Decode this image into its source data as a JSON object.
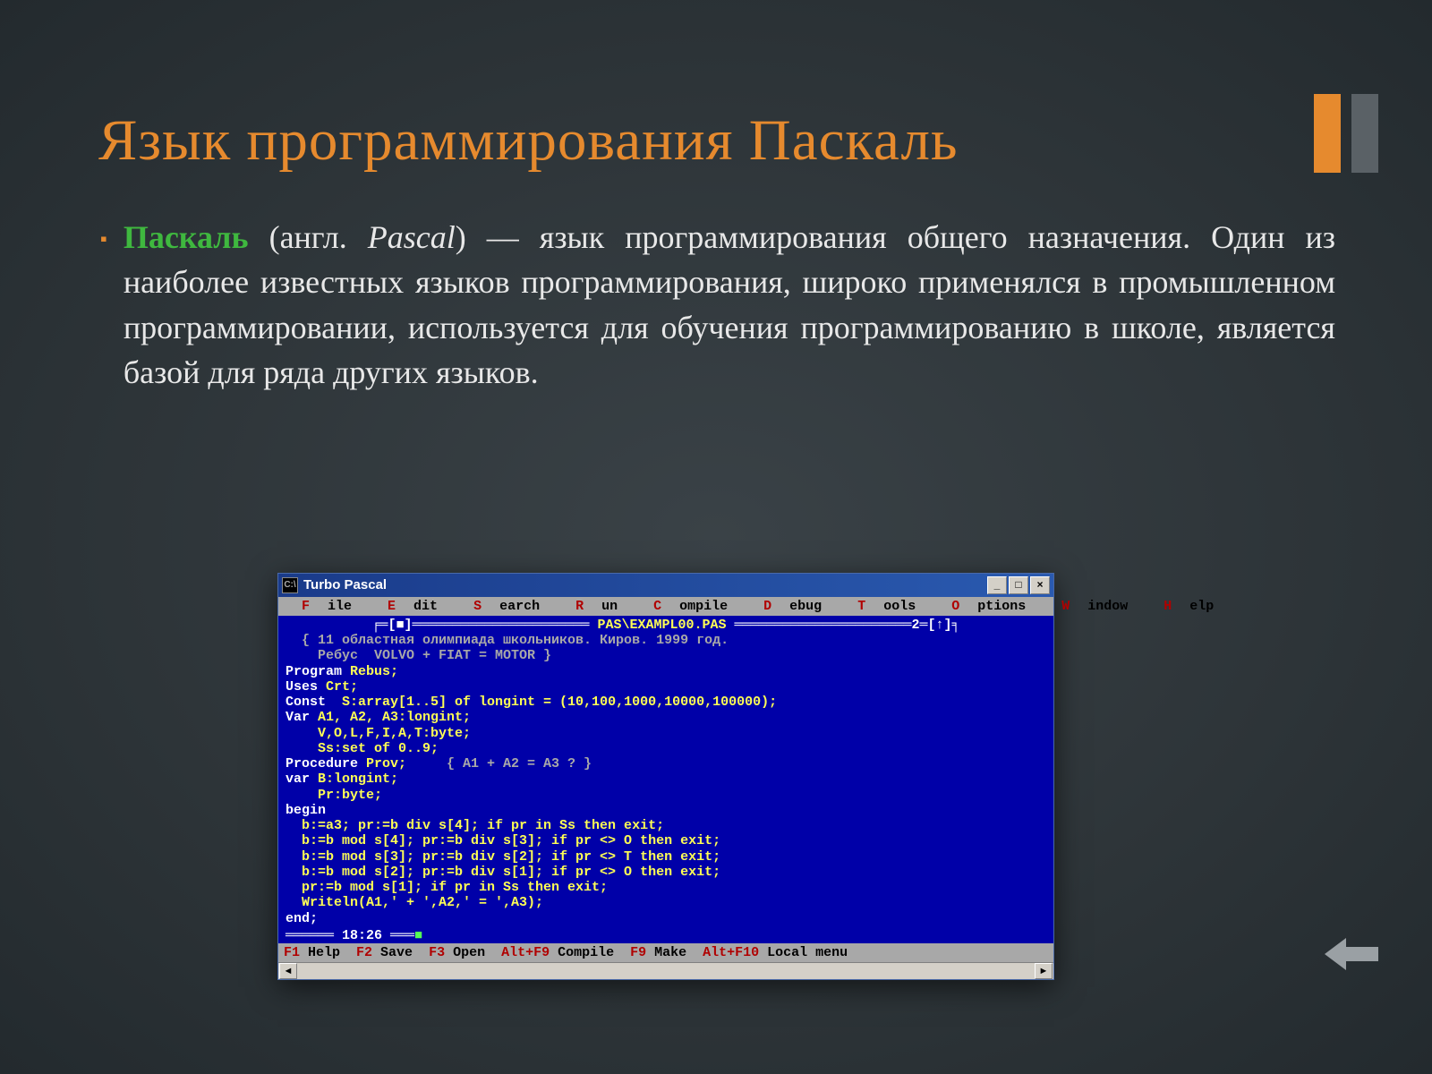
{
  "slide": {
    "title": "Язык программирования Паскаль",
    "bullet_glyph": "▪",
    "term": "Паскаль",
    "parenthetical_prefix": " (англ. ",
    "english_name": "Pascal",
    "parenthetical_suffix": ") — язык программирования общего назначения. Один из наиболее известных языков программирования, широко применялся в промышленном программировании, используется для обучения программированию в школе, является базой для ряда других языков."
  },
  "tp_window": {
    "title": "Turbo Pascal",
    "sys_icon": "C:\\",
    "min": "_",
    "max": "□",
    "close": "×",
    "menu": {
      "file": {
        "hot": "F",
        "rest": "ile"
      },
      "edit": {
        "hot": "E",
        "rest": "dit"
      },
      "search": {
        "hot": "S",
        "rest": "earch"
      },
      "run": {
        "hot": "R",
        "rest": "un"
      },
      "compile": {
        "hot": "C",
        "rest": "ompile"
      },
      "debug": {
        "hot": "D",
        "rest": "ebug"
      },
      "tools": {
        "hot": "T",
        "rest": "ools"
      },
      "options": {
        "hot": "O",
        "rest": "ptions"
      },
      "window": {
        "hot": "W",
        "rest": "indow"
      },
      "help": {
        "hot": "H",
        "rest": "elp"
      }
    },
    "file_header_prefix": "╒═[■]══════════════════════ ",
    "file_header_name": "PAS\\EXAMPL00.PAS",
    "file_header_suffix": " ══════════════════════2═[↑]╕",
    "code": {
      "l1a": "  { 11 областная олимпиада школьников. Киров. 1999 год.",
      "l1b": "    Ребус  VOLVO + FIAT = MOTOR }",
      "l2": "Program ",
      "l2b": "Rebus;",
      "l3": "Uses ",
      "l3b": "Crt;",
      "l4": "Const  ",
      "l4b": "S:array[1..5] of longint = (10,100,1000,10000,100000);",
      "l5": "Var ",
      "l5b": "A1, A2, A3:longint;",
      "l5c": "    V,O,L,F,I,A,T:byte;",
      "l5d": "    Ss:set of 0..9;",
      "l6": "Procedure ",
      "l6b": "Prov;     ",
      "l6c": "{ A1 + A2 = A3 ? }",
      "l7": "var ",
      "l7b": "B:longint;",
      "l7c": "    Pr:byte;",
      "l8": "begin",
      "l9a": "  b:=a3; pr:=b div s[4]; if pr in Ss then exit;",
      "l9b": "  b:=b mod s[4]; pr:=b div s[3]; if pr <> O then exit;",
      "l9c": "  b:=b mod s[3]; pr:=b div s[2]; if pr <> T then exit;",
      "l9d": "  b:=b mod s[2]; pr:=b div s[1]; if pr <> O then exit;",
      "l9e": "  pr:=b mod s[1]; if pr in Ss then exit;",
      "l9f": "  Writeln(A1,' + ',A2,' = ',A3);",
      "l10": "end;"
    },
    "clock_prefix": "══════ ",
    "clock": "18:26",
    "clock_suffix": " ═══",
    "scroll_marker": "■",
    "status": {
      "f1k": "F1",
      "f1t": " Help  ",
      "f2k": "F2",
      "f2t": " Save  ",
      "f3k": "F3",
      "f3t": " Open  ",
      "f4k": "Alt+F9",
      "f4t": " Compile  ",
      "f5k": "F9",
      "f5t": " Make  ",
      "f6k": "Alt+F10",
      "f6t": " Local menu"
    },
    "arrow_left": "◄",
    "arrow_right": "►"
  },
  "nav": {
    "back_arrow_title": "Назад"
  }
}
